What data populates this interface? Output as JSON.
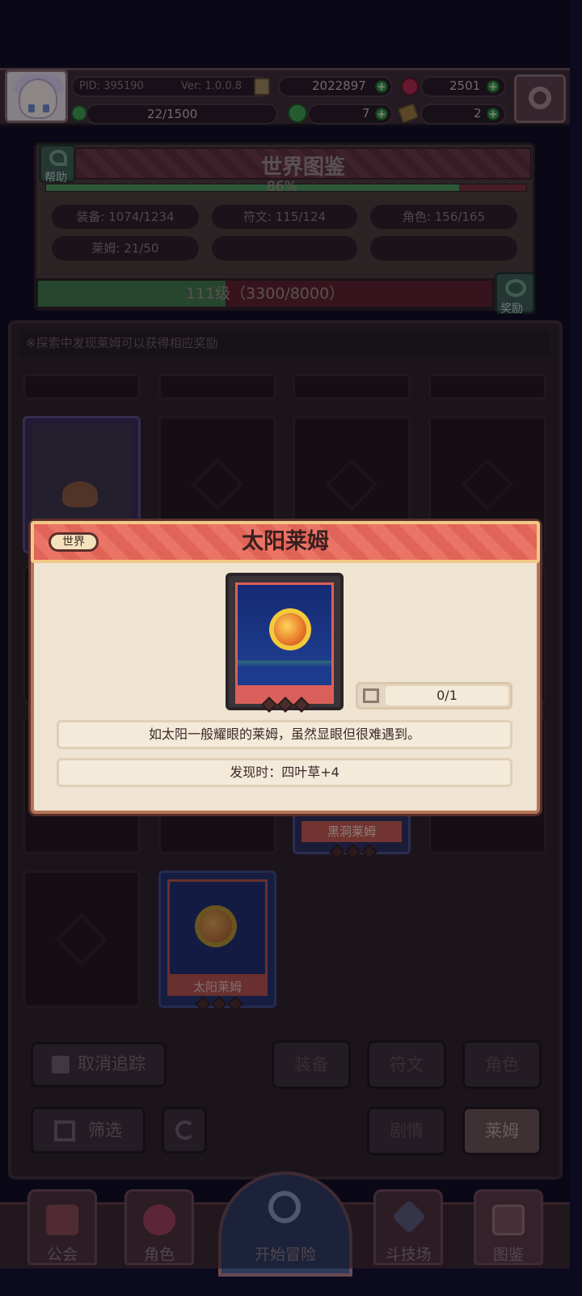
{
  "header": {
    "pid": "PID: 395190",
    "version": "Ver: 1.0.0.8",
    "gold": "2022897",
    "gems": "2501",
    "energy": "22/1500",
    "clover": "7",
    "key": "2"
  },
  "codex": {
    "title": "世界图鉴",
    "help_label": "帮助",
    "progress": "86%",
    "progress_value": 0.86,
    "stats": [
      "装备: 1074/1234",
      "符文: 115/124",
      "角色: 156/165",
      "莱姆: 21/50"
    ],
    "level": "111级（3300/8000）",
    "level_fill": 0.4125,
    "reward_label": "奖励"
  },
  "collection": {
    "hint": "※探索中发现莱姆可以获得相应奖励",
    "visible_cards": [
      {
        "name": "黑洞莱姆",
        "stars": 3
      },
      {
        "name": "太阳莱姆",
        "stars": 3
      }
    ]
  },
  "buttons": {
    "untrack": "取消追踪",
    "filter": "筛选",
    "equip": "装备",
    "rune": "符文",
    "character": "角色",
    "story": "剧情",
    "lime": "莱姆"
  },
  "nav": {
    "guild": "公会",
    "character": "角色",
    "adventure": "开始冒险",
    "arena": "斗技场",
    "codex": "图鉴"
  },
  "modal": {
    "tag": "世界",
    "title": "太阳莱姆",
    "count": "0/1",
    "description": "如太阳一般耀眼的莱姆，虽然显眼但很难遇到。",
    "discover": "发现时：四叶草+4",
    "stars": 3
  },
  "colors": {
    "modal_header": "#e06458",
    "modal_body": "#efe3d2",
    "background": "#0b0a1e",
    "progress_green": "#4b9b5a"
  }
}
